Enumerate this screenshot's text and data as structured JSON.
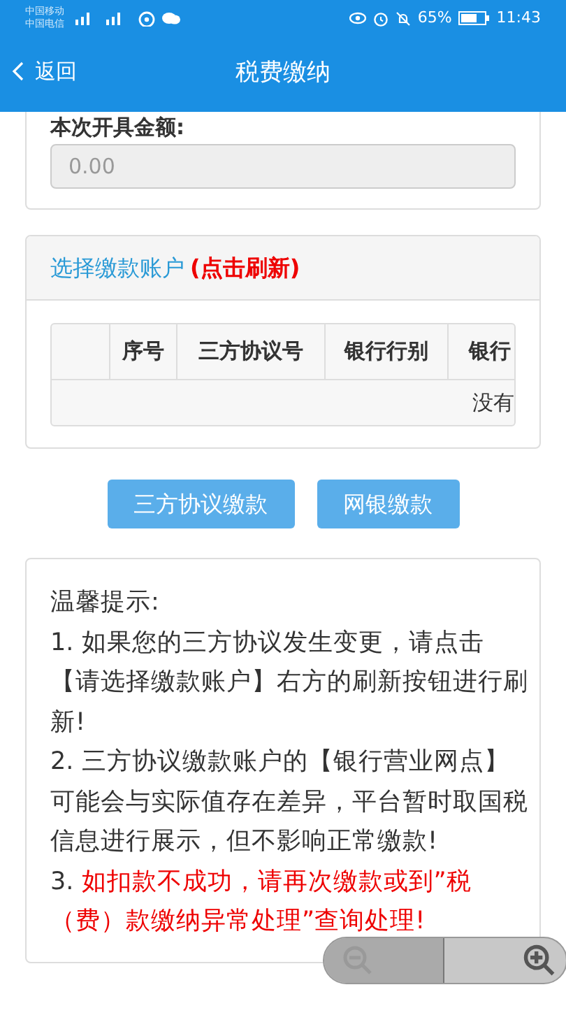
{
  "status_bar": {
    "carriers": [
      "中国移动",
      "中国电信"
    ],
    "battery": "65%",
    "time": "11:43"
  },
  "header": {
    "back": "返回",
    "title": "税费缴纳"
  },
  "amount": {
    "label": "本次开具金额:",
    "placeholder": "0.00"
  },
  "account": {
    "title": "选择缴款账户",
    "refresh": "(点击刷新)",
    "columns": [
      "",
      "序号",
      "三方协议号",
      "银行行别",
      "银行"
    ],
    "empty_message": "没有"
  },
  "buttons": [
    "三方协议缴款",
    "网银缴款"
  ],
  "tips": {
    "title": "温馨提示:",
    "items": [
      {
        "number": "1.",
        "text": "如果您的三方协议发生变更，请点击【请选择缴款账户】右方的刷新按钮进行刷新!",
        "alert": false
      },
      {
        "number": "2.",
        "text": "三方协议缴款账户的【银行营业网点】可能会与实际值存在差异，平台暂时取国税信息进行展示，但不影响正常缴款!",
        "alert": false
      },
      {
        "number": "3.",
        "text": "如扣款不成功，请再次缴款或到”税（费）款缴纳异常处理”查询处理!",
        "alert": true
      }
    ]
  }
}
